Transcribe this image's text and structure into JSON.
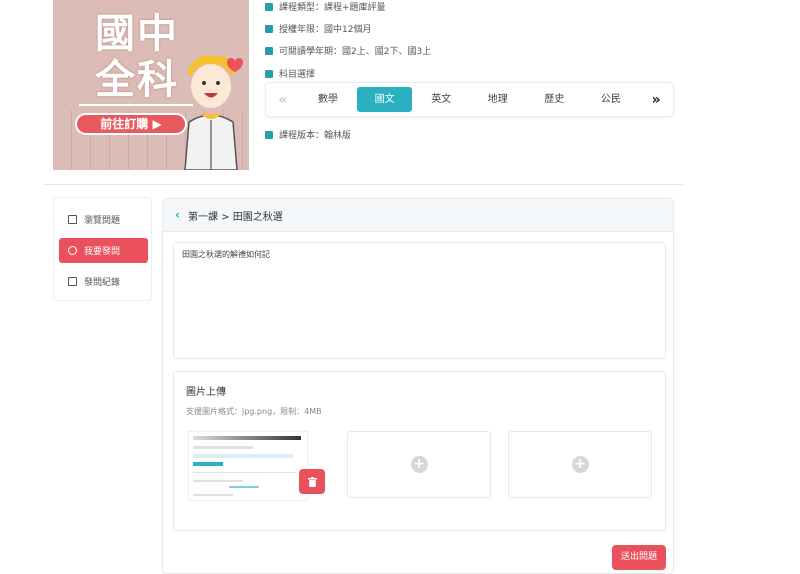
{
  "banner": {
    "line1": "國中",
    "line2": "全科",
    "cta": "前往訂購 ▶"
  },
  "course_info": {
    "type": "課程類型：課程+題庫評量",
    "period": "授權年限：國中12個月",
    "terms": "可閱讀學年期：國2上、國2下、國3上",
    "subject_select": "科目選擇",
    "version": "課程版本：翰林版"
  },
  "subjects": {
    "items": [
      "數學",
      "國文",
      "英文",
      "地理",
      "歷史",
      "公民"
    ],
    "active": "國文"
  },
  "sidebar": {
    "items": [
      {
        "label": "瀏覽問題",
        "active": false
      },
      {
        "label": "我要發問",
        "active": true
      },
      {
        "label": "發問紀錄",
        "active": false
      }
    ]
  },
  "panel": {
    "breadcrumb": "第一課 > 田園之秋選",
    "question_text": "田園之秋選的解禮如何記",
    "upload_title": "圖片上傳",
    "upload_hint": "支援圖片格式：jpg.png，限制：4MB",
    "submit_label": "送出問題"
  },
  "colors": {
    "accent": "#2ab0c0",
    "danger": "#e9525d"
  }
}
